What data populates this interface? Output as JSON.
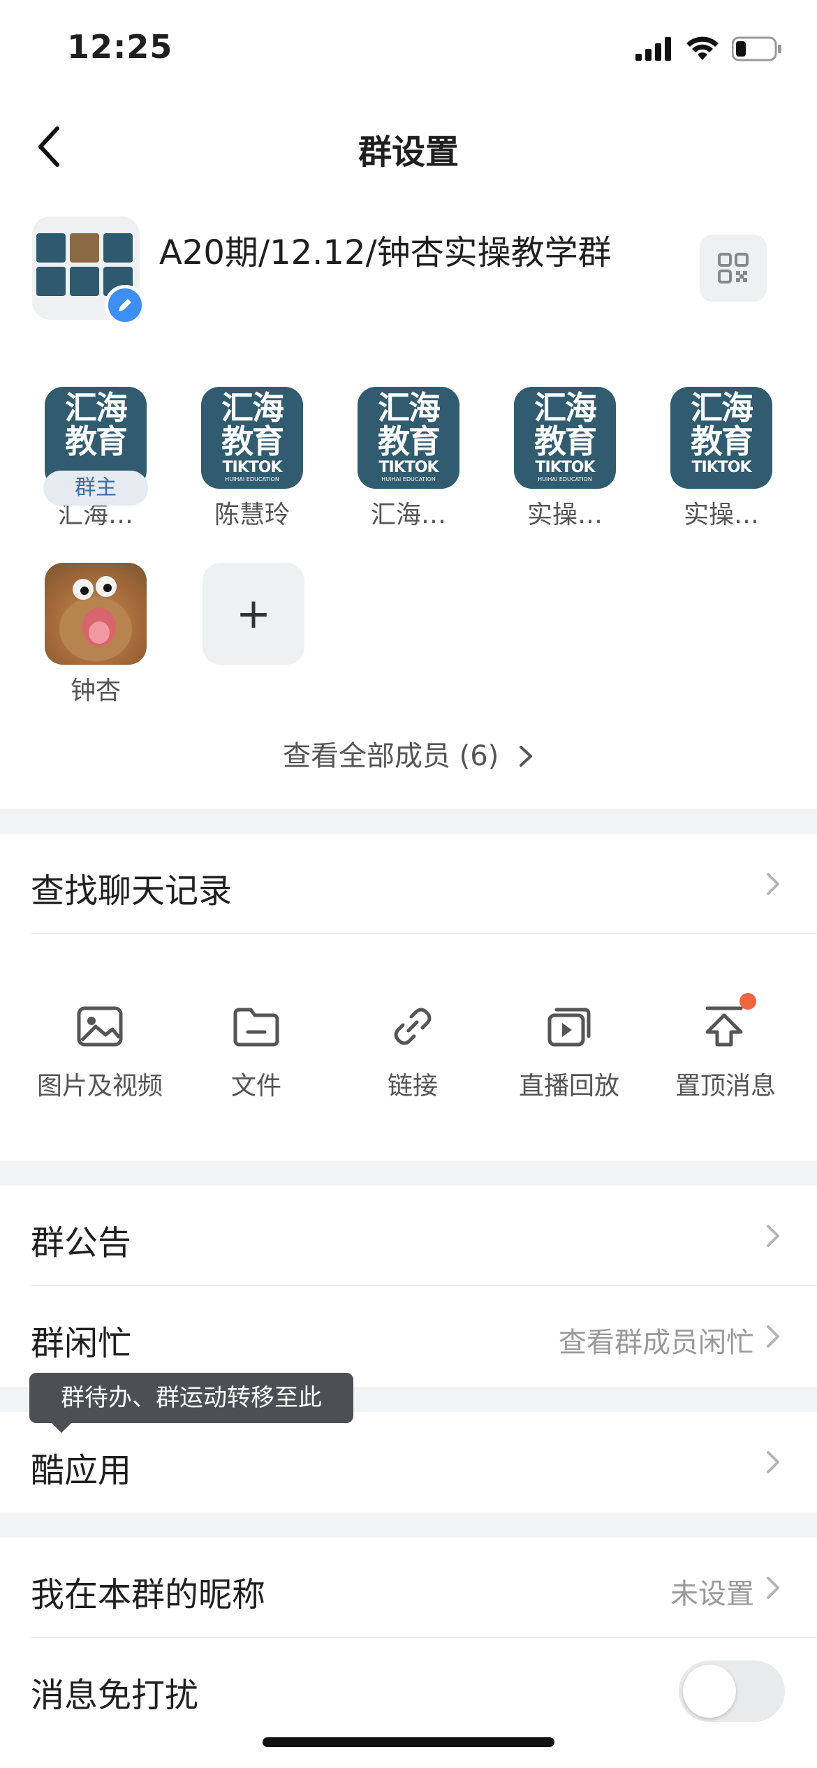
{
  "status_bar": {
    "time": "12:25"
  },
  "nav": {
    "title": "群设置"
  },
  "group": {
    "name": "A20期/12.12/钟杏实操教学群"
  },
  "members": [
    {
      "name": "汇海…",
      "type": "logo",
      "owner": true
    },
    {
      "name": "陈慧玲",
      "type": "logo",
      "owner": false
    },
    {
      "name": "汇海…",
      "type": "logo",
      "owner": false
    },
    {
      "name": "实操…",
      "type": "logo",
      "owner": false
    },
    {
      "name": "实操…",
      "type": "logo",
      "owner": false
    },
    {
      "name": "钟杏",
      "type": "photo",
      "owner": false
    }
  ],
  "member_logo": {
    "line1": "汇海",
    "line2": "教育",
    "line3": "TIKTOK",
    "line4": "HUIHAI EDUCATION"
  },
  "owner_tag": "群主",
  "add_member_label": "+",
  "view_all": "查看全部成员 (6)",
  "search_history": {
    "label": "查找聊天记录"
  },
  "quick_actions": [
    {
      "label": "图片及视频",
      "icon": "image-icon"
    },
    {
      "label": "文件",
      "icon": "folder-icon"
    },
    {
      "label": "链接",
      "icon": "link-icon"
    },
    {
      "label": "直播回放",
      "icon": "playback-icon"
    },
    {
      "label": "置顶消息",
      "icon": "pin-top-icon",
      "badge": true
    }
  ],
  "settings": {
    "announcement": {
      "label": "群公告"
    },
    "busy": {
      "label": "群闲忙",
      "value": "查看群成员闲忙"
    },
    "apps": {
      "label": "酷应用"
    },
    "nickname": {
      "label": "我在本群的昵称",
      "value": "未设置"
    },
    "mute": {
      "label": "消息免打扰",
      "enabled": false
    }
  },
  "tooltip": "群待办、群运动转移至此",
  "colors": {
    "accent": "#3e8ef7",
    "logo_bg": "#315c70",
    "badge": "#f2663f"
  }
}
